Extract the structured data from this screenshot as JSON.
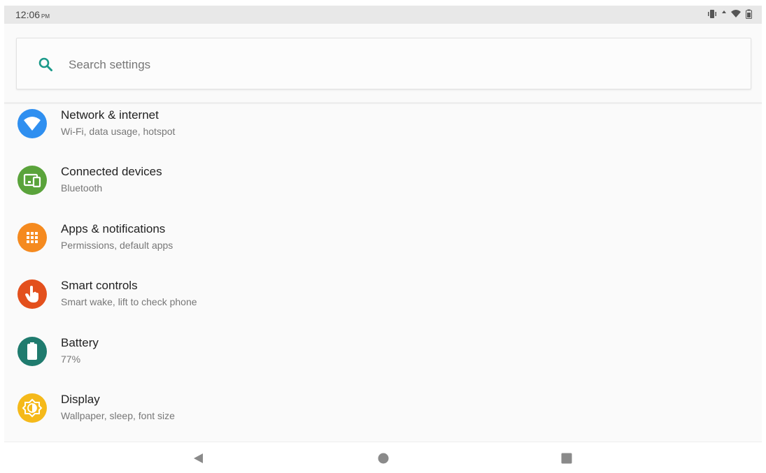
{
  "status_bar": {
    "time": "12:06",
    "ampm": "PM"
  },
  "search": {
    "placeholder": "Search settings",
    "value": ""
  },
  "settings": {
    "items": [
      {
        "title": "Network & internet",
        "subtitle": "Wi-Fi, data usage, hotspot",
        "icon": "wifi-icon",
        "color": "#2f8ff0"
      },
      {
        "title": "Connected devices",
        "subtitle": "Bluetooth",
        "icon": "devices-icon",
        "color": "#5aa33b"
      },
      {
        "title": "Apps & notifications",
        "subtitle": "Permissions, default apps",
        "icon": "apps-icon",
        "color": "#f58a1f"
      },
      {
        "title": "Smart controls",
        "subtitle": "Smart wake, lift to check phone",
        "icon": "hand-icon",
        "color": "#e3501d"
      },
      {
        "title": "Battery",
        "subtitle": "77%",
        "icon": "battery-icon",
        "color": "#1f7b6e"
      },
      {
        "title": "Display",
        "subtitle": "Wallpaper, sleep, font size",
        "icon": "brightness-icon",
        "color": "#f5b91a"
      }
    ]
  },
  "nav": {
    "back": "back-icon",
    "home": "home-icon",
    "recents": "recents-icon"
  },
  "colors": {
    "accent": "#1b9a8a",
    "status_bar": "#e8e8e8",
    "background": "#fafafa"
  }
}
